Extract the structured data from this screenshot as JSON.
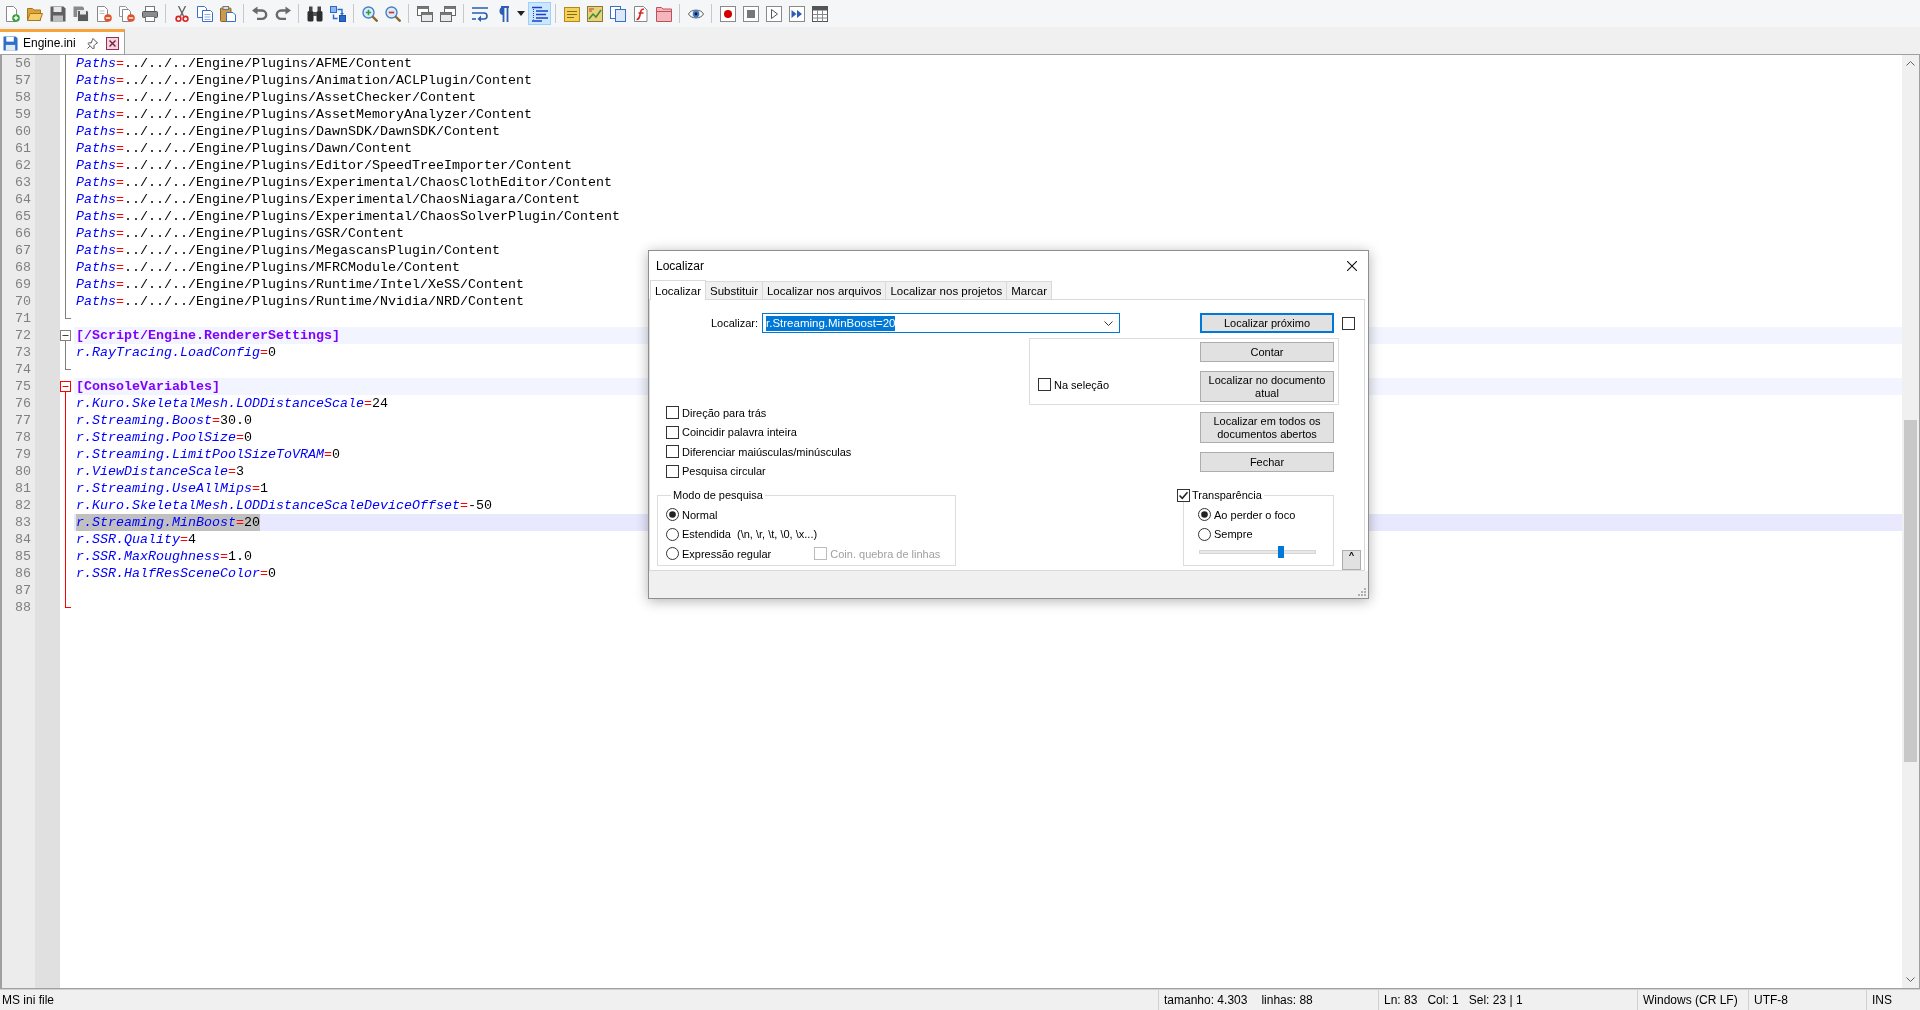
{
  "toolbar": {
    "groups": [
      [
        {
          "pressed": false
        },
        {
          "pressed": false
        },
        {
          "pressed": false
        },
        {
          "pressed": false
        },
        {
          "pressed": false
        },
        {
          "pressed": false
        },
        {
          "pressed": false
        }
      ],
      [
        {
          "pressed": false
        },
        {
          "pressed": false
        },
        {
          "pressed": false
        }
      ],
      [
        {
          "pressed": false
        },
        {
          "pressed": false
        }
      ],
      [
        {
          "pressed": false
        },
        {
          "pressed": false
        }
      ],
      [
        {
          "pressed": false
        },
        {
          "pressed": false
        }
      ],
      [
        {
          "pressed": false
        },
        {
          "pressed": false
        }
      ],
      [
        {
          "pressed": false
        },
        {
          "pressed": false
        },
        {
          "pressed": false
        },
        {
          "pressed": true
        }
      ],
      [
        {
          "pressed": false
        },
        {
          "pressed": false
        },
        {
          "pressed": false
        },
        {
          "pressed": false
        },
        {
          "pressed": false
        }
      ],
      [
        {
          "pressed": false
        }
      ],
      [
        {
          "pressed": false
        },
        {
          "pressed": false
        },
        {
          "pressed": false
        },
        {
          "pressed": false
        },
        {
          "pressed": false
        }
      ]
    ]
  },
  "tabs": [
    {
      "label": "Engine.ini",
      "selected": true,
      "modified": false
    }
  ],
  "editor": {
    "blocks": [
      {
        "active": false,
        "lines": [
          {
            "number": "56",
            "kind": "entry",
            "key": "Paths",
            "sep": "=",
            "value": "../../../Engine/Plugins/AFME/Content",
            "selected": false
          },
          {
            "number": "57",
            "kind": "entry",
            "key": "Paths",
            "sep": "=",
            "value": "../../../Engine/Plugins/Animation/ACLPlugin/Content",
            "selected": false
          },
          {
            "number": "58",
            "kind": "entry",
            "key": "Paths",
            "sep": "=",
            "value": "../../../Engine/Plugins/AssetChecker/Content",
            "selected": false
          },
          {
            "number": "59",
            "kind": "entry",
            "key": "Paths",
            "sep": "=",
            "value": "../../../Engine/Plugins/AssetMemoryAnalyzer/Content",
            "selected": false
          },
          {
            "number": "60",
            "kind": "entry",
            "key": "Paths",
            "sep": "=",
            "value": "../../../Engine/Plugins/DawnSDK/DawnSDK/Content",
            "selected": false
          },
          {
            "number": "61",
            "kind": "entry",
            "key": "Paths",
            "sep": "=",
            "value": "../../../Engine/Plugins/Dawn/Content",
            "selected": false
          },
          {
            "number": "62",
            "kind": "entry",
            "key": "Paths",
            "sep": "=",
            "value": "../../../Engine/Plugins/Editor/SpeedTreeImporter/Content",
            "selected": false
          },
          {
            "number": "63",
            "kind": "entry",
            "key": "Paths",
            "sep": "=",
            "value": "../../../Engine/Plugins/Experimental/ChaosClothEditor/Content",
            "selected": false
          },
          {
            "number": "64",
            "kind": "entry",
            "key": "Paths",
            "sep": "=",
            "value": "../../../Engine/Plugins/Experimental/ChaosNiagara/Content",
            "selected": false
          },
          {
            "number": "65",
            "kind": "entry",
            "key": "Paths",
            "sep": "=",
            "value": "../../../Engine/Plugins/Experimental/ChaosSolverPlugin/Content",
            "selected": false
          },
          {
            "number": "66",
            "kind": "entry",
            "key": "Paths",
            "sep": "=",
            "value": "../../../Engine/Plugins/GSR/Content",
            "selected": false
          },
          {
            "number": "67",
            "kind": "entry",
            "key": "Paths",
            "sep": "=",
            "value": "../../../Engine/Plugins/MegascansPlugin/Content",
            "selected": false
          },
          {
            "number": "68",
            "kind": "entry",
            "key": "Paths",
            "sep": "=",
            "value": "../../../Engine/Plugins/MFRCModule/Content",
            "selected": false
          },
          {
            "number": "69",
            "kind": "entry",
            "key": "Paths",
            "sep": "=",
            "value": "../../../Engine/Plugins/Runtime/Intel/XeSS/Content",
            "selected": false
          },
          {
            "number": "70",
            "kind": "entry",
            "key": "Paths",
            "sep": "=",
            "value": "../../../Engine/Plugins/Runtime/Nvidia/NRD/Content",
            "selected": false
          },
          {
            "number": "71",
            "kind": "blank",
            "selected": false
          }
        ]
      },
      {
        "header": {
          "number": "72",
          "text": "[/Script/Engine.RendererSettings]",
          "expanded": true
        },
        "active": false,
        "lines": [
          {
            "number": "73",
            "kind": "entry",
            "key": "r.RayTracing.LoadConfig",
            "sep": "=",
            "value": "0",
            "selected": false
          },
          {
            "number": "74",
            "kind": "blank",
            "selected": false
          }
        ]
      },
      {
        "header": {
          "number": "75",
          "text": "[ConsoleVariables]",
          "expanded": true
        },
        "active": true,
        "lines": [
          {
            "number": "76",
            "kind": "entry",
            "key": "r.Kuro.SkeletalMesh.LODDistanceScale",
            "sep": "=",
            "value": "24",
            "selected": false
          },
          {
            "number": "77",
            "kind": "entry",
            "key": "r.Streaming.Boost",
            "sep": "=",
            "value": "30.0",
            "selected": false
          },
          {
            "number": "78",
            "kind": "entry",
            "key": "r.Streaming.PoolSize",
            "sep": "=",
            "value": "0",
            "selected": false
          },
          {
            "number": "79",
            "kind": "entry",
            "key": "r.Streaming.LimitPoolSizeToVRAM",
            "sep": "=",
            "value": "0",
            "selected": false
          },
          {
            "number": "80",
            "kind": "entry",
            "key": "r.ViewDistanceScale",
            "sep": "=",
            "value": "3",
            "selected": false
          },
          {
            "number": "81",
            "kind": "entry",
            "key": "r.Streaming.UseAllMips",
            "sep": "=",
            "value": "1",
            "selected": false
          },
          {
            "number": "82",
            "kind": "entry",
            "key": "r.Kuro.SkeletalMesh.LODDistanceScaleDeviceOffset",
            "sep": "=",
            "value": "-50",
            "selected": false
          },
          {
            "number": "83",
            "kind": "entry",
            "key": "r.Streaming.MinBoost",
            "sep": "=",
            "value": "20",
            "selected": true
          },
          {
            "number": "84",
            "kind": "entry",
            "key": "r.SSR.Quality",
            "sep": "=",
            "value": "4",
            "selected": false
          },
          {
            "number": "85",
            "kind": "entry",
            "key": "r.SSR.MaxRoughness",
            "sep": "=",
            "value": "1.0",
            "selected": false
          },
          {
            "number": "86",
            "kind": "entry",
            "key": "r.SSR.HalfResSceneColor",
            "sep": "=",
            "value": "0",
            "selected": false
          },
          {
            "number": "87",
            "kind": "blank",
            "selected": false
          },
          {
            "number": "88",
            "kind": "blank",
            "selected": false
          }
        ]
      }
    ]
  },
  "find_dialog": {
    "title": "Localizar",
    "tabs": [
      {
        "label": "Localizar",
        "selected": true
      },
      {
        "label": "Substituir",
        "selected": false
      },
      {
        "label": "Localizar nos arquivos",
        "selected": false
      },
      {
        "label": "Localizar nos projetos",
        "selected": false
      },
      {
        "label": "Marcar",
        "selected": false
      }
    ],
    "search": {
      "label": "Localizar:",
      "value": "r.Streaming.MinBoost=20",
      "value_selected": true
    },
    "find_next": {
      "label": "Localizar próximo",
      "default": true
    },
    "two_buttons_mode": {
      "checked": false
    },
    "in_selection": {
      "label": "Na seleção",
      "checked": false,
      "buttons": [
        {
          "label": "Contar",
          "default": false
        },
        {
          "label": "Localizar no documento atual",
          "default": false
        }
      ]
    },
    "buttons": [
      {
        "label": "Localizar em todos os documentos abertos",
        "default": false
      },
      {
        "label": "Fechar",
        "default": false
      }
    ],
    "options": [
      {
        "label": "Direção para trás",
        "checked": false
      },
      {
        "label": "Coincidir palavra inteira",
        "checked": false
      },
      {
        "label": "Diferenciar maiúsculas/minúsculas",
        "checked": false
      },
      {
        "label": "Pesquisa circular",
        "checked": false
      }
    ],
    "search_mode": {
      "title": "Modo de pesquisa",
      "options": [
        {
          "label": "Normal",
          "selected": true
        },
        {
          "label": "Estendida  (\\n, \\r, \\t, \\0, \\x...)",
          "selected": false
        },
        {
          "label": "Expressão regular",
          "selected": false,
          "checkbox": {
            "label": "Coin. quebra de linhas",
            "checked": false,
            "disabled": true
          }
        }
      ]
    },
    "transparency": {
      "label": "Transparência",
      "checked": true,
      "options": [
        {
          "label": "Ao perder o foco",
          "selected": true
        },
        {
          "label": "Sempre",
          "selected": false
        }
      ],
      "level": 0.7
    },
    "collapse_button": {
      "label": "˄"
    }
  },
  "status_bar": {
    "file_type": "MS ini file",
    "length": "tamanho: 4.303",
    "lines": "linhas: 88",
    "line": "Ln: 83",
    "column": "Col: 1",
    "selection": "Sel: 23 | 1",
    "eol": "Windows (CR LF)",
    "encoding": "UTF-8",
    "mode": "INS"
  }
}
